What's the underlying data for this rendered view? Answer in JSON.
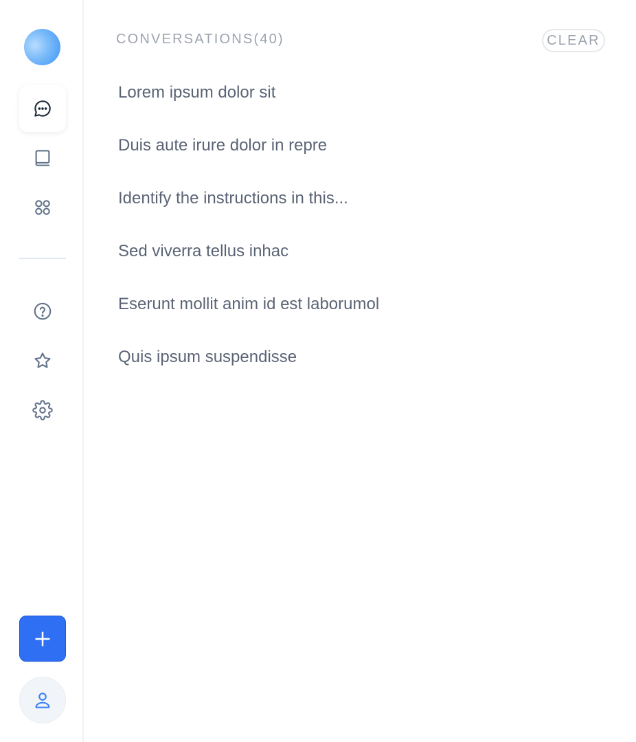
{
  "sidebar": {
    "nav_top": [
      {
        "icon": "chat-bubble-icon",
        "active": true
      },
      {
        "icon": "book-icon",
        "active": false
      },
      {
        "icon": "apps-grid-icon",
        "active": false
      }
    ],
    "nav_bottom": [
      {
        "icon": "help-circle-icon"
      },
      {
        "icon": "star-icon"
      },
      {
        "icon": "gear-icon"
      }
    ],
    "new_button_icon": "plus-icon",
    "user_button_icon": "user-icon"
  },
  "conversations": {
    "header": "CONVERSATIONS(40)",
    "clear_label": "CLEAR",
    "items": [
      "Lorem ipsum dolor sit",
      "Duis aute irure dolor in repre",
      "Identify the instructions in this...",
      "Sed viverra tellus inhac",
      "Eserunt mollit anim id est laborumol",
      "Quis ipsum suspendisse"
    ]
  },
  "colors": {
    "accent": "#2f6ff3",
    "text_primary": "#5b6475",
    "text_muted": "#9ca3af"
  }
}
